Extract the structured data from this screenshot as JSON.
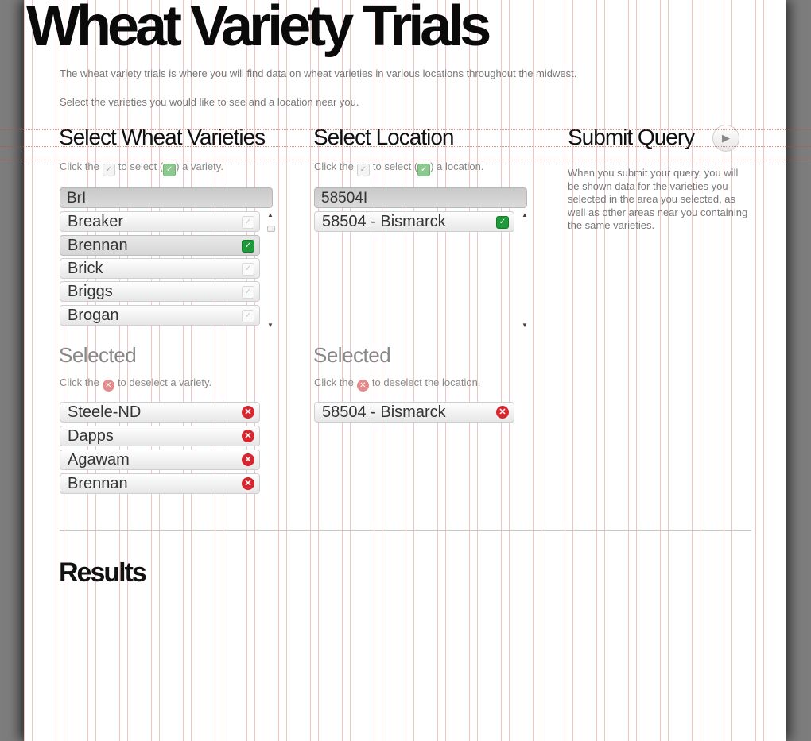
{
  "header": {
    "title": "Wheat Variety Trials",
    "intro_1": "The wheat variety trials is where you will find data on wheat varieties in various locations throughout the midwest.",
    "intro_2": "Select the varieties you would like to see and a location near you."
  },
  "varieties": {
    "title": "Select Wheat Varieties",
    "hint_pre": "Click the",
    "hint_mid": "to select (",
    "hint_post": ") a variety.",
    "search_value": "Br",
    "options": [
      {
        "label": "Breaker",
        "checked": false
      },
      {
        "label": "Brennan",
        "checked": true
      },
      {
        "label": "Brick",
        "checked": false
      },
      {
        "label": "Briggs",
        "checked": false
      },
      {
        "label": "Brogan",
        "checked": false
      }
    ],
    "selected_title": "Selected",
    "selected_hint_pre": "Click the",
    "selected_hint_post": "to deselect a variety.",
    "selected": [
      "Steele-ND",
      "Dapps",
      "Agawam",
      "Brennan"
    ]
  },
  "location": {
    "title": "Select Location",
    "hint_pre": "Click the",
    "hint_mid": "to select (",
    "hint_post": ") a location.",
    "search_value": "58504",
    "options": [
      {
        "label": "58504 - Bismarck",
        "checked": true
      }
    ],
    "selected_title": "Selected",
    "selected_hint_pre": "Click the",
    "selected_hint_post": "to deselect the location.",
    "selected": [
      "58504 - Bismarck"
    ]
  },
  "submit": {
    "title": "Submit Query",
    "description": "When you submit your query, you will be shown data for the varieties you selected in the area you selected, as well as other areas near you containing the same varieties."
  },
  "results": {
    "title": "Results"
  },
  "colors": {
    "check_on": "#1f9a3a",
    "remove": "#d8242c",
    "grid": "#d63c3c"
  }
}
